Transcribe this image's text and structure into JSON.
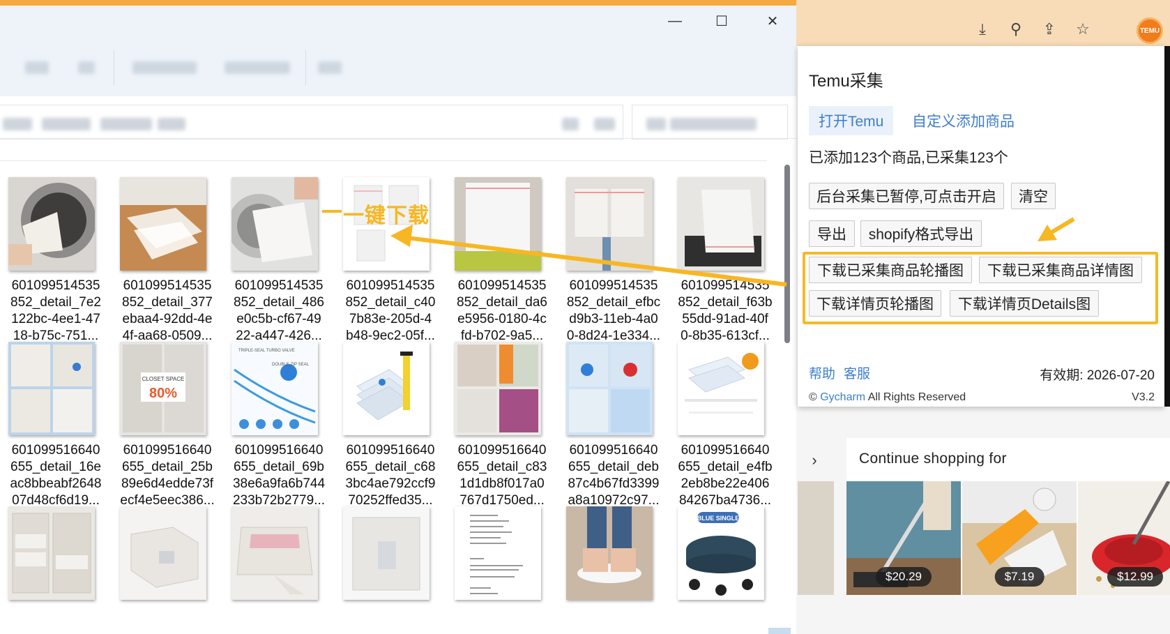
{
  "explorer": {
    "window_controls": {
      "minimize": "—",
      "maximize": "☐",
      "close": "✕"
    },
    "files": [
      {
        "name": "601099514535\n852_detail_7e2\n122bc-4ee1-47\n18-b75c-751..."
      },
      {
        "name": "601099514535\n852_detail_377\nebaa4-92dd-4e\n4f-aa68-0509..."
      },
      {
        "name": "601099514535\n852_detail_486\ne0c5b-cf67-49\n22-a447-426..."
      },
      {
        "name": "601099514535\n852_detail_c40\n7b83e-205d-4\nb48-9ec2-05f..."
      },
      {
        "name": "601099514535\n852_detail_da6\ne5956-0180-4c\nfd-b702-9a5..."
      },
      {
        "name": "601099514535\n852_detail_efbc\nd9b3-11eb-4a0\n0-8d24-1e334..."
      },
      {
        "name": "601099514535\n852_detail_f63b\n55dd-91ad-40f\n0-8b35-613cf..."
      },
      {
        "name": "601099516640\n655_detail_16e\nac8bbeabf2648\n07d48cf6d19..."
      },
      {
        "name": "601099516640\n655_detail_25b\n89e6d4edde73f\necf4e5eec386..."
      },
      {
        "name": "601099516640\n655_detail_69b\n38e6a9fa6b744\n233b72b2779..."
      },
      {
        "name": "601099516640\n655_detail_c68\n3bc4ae792ccf9\n70252ffed35..."
      },
      {
        "name": "601099516640\n655_detail_c83\n1d1db8f017a0\n767d1750ed..."
      },
      {
        "name": "601099516640\n655_detail_deb\n87c4b67fd3399\na8a10972c97..."
      },
      {
        "name": "601099516640\n655_detail_e4fb\n2eb8be22e406\n84267ba4736..."
      },
      {
        "name": ""
      },
      {
        "name": ""
      },
      {
        "name": ""
      },
      {
        "name": ""
      },
      {
        "name": ""
      },
      {
        "name": ""
      },
      {
        "name": ""
      }
    ],
    "thumb_texts": {
      "closet_space": "CLOSET SPACE",
      "closet_pct": "80%",
      "turbo_valve": "TRIPLE-SEAL TURBO VALVE",
      "double_zip": "DOUBLE-ZIP SEAL",
      "blue_single": "BLUE SINGLE"
    }
  },
  "annotation": {
    "label": "一键下载",
    "color": "#f7b722"
  },
  "browser": {
    "toolbar_icons": [
      "download-icon",
      "zoom-icon",
      "share-icon",
      "bookmark-star-icon"
    ],
    "toolbar_glyphs": {
      "download": "⤓",
      "zoom": "⚲",
      "share": "⇪",
      "star": "☆"
    },
    "extension_label": "TEMU"
  },
  "popup": {
    "title": "Temu采集",
    "open_temu": "打开Temu",
    "custom_add": "自定义添加商品",
    "status": "已添加123个商品,已采集123个",
    "buttons": {
      "resume": "后台采集已暂停,可点击开启",
      "clear": "清空",
      "export": "导出",
      "shopify_export": "shopify格式导出",
      "dl_carousel": "下载已采集商品轮播图",
      "dl_detail": "下载已采集商品详情图",
      "dl_page_carousel": "下载详情页轮播图",
      "dl_page_details": "下载详情页Details图"
    },
    "footer": {
      "help": "帮助",
      "service": "客服",
      "expire": "有效期: 2026-07-20",
      "copyright_prefix": "© ",
      "brand": "Gycharm",
      "copyright_suffix": " All Rights Reserved",
      "version": "V3.2"
    }
  },
  "shopping": {
    "title": "Continue shopping for",
    "products": [
      {
        "price": "$20.29"
      },
      {
        "price": "$7.19"
      },
      {
        "price": "$12.99"
      }
    ],
    "arrow": "›"
  }
}
